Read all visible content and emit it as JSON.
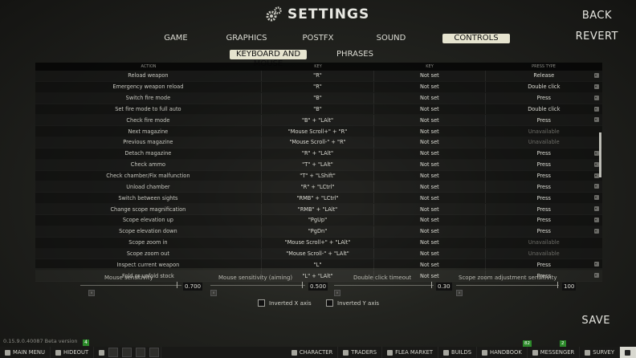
{
  "header": {
    "title": "SETTINGS"
  },
  "side": {
    "back": "BACK",
    "revert": "REVERT",
    "save": "SAVE"
  },
  "tabs": [
    {
      "label": "GAME"
    },
    {
      "label": "GRAPHICS"
    },
    {
      "label": "POSTFX"
    },
    {
      "label": "SOUND"
    },
    {
      "label": "CONTROLS"
    }
  ],
  "subtabs": [
    {
      "label": "KEYBOARD AND MOUSE"
    },
    {
      "label": "PHRASES"
    }
  ],
  "table": {
    "headers": [
      "ACTION",
      "KEY",
      "KEY",
      "PRESS TYPE"
    ],
    "rows": [
      {
        "action": "Reload weapon",
        "key": "\"R\"",
        "key2": "Not set",
        "press": "Release"
      },
      {
        "action": "Emergency weapon reload",
        "key": "\"R\"",
        "key2": "Not set",
        "press": "Double click"
      },
      {
        "action": "Switch fire mode",
        "key": "\"B\"",
        "key2": "Not set",
        "press": "Press"
      },
      {
        "action": "Set fire mode to full auto",
        "key": "\"B\"",
        "key2": "Not set",
        "press": "Double click"
      },
      {
        "action": "Check fire mode",
        "key": "\"B\" + \"LAlt\"",
        "key2": "Not set",
        "press": "Press"
      },
      {
        "action": "Next magazine",
        "key": "\"Mouse Scroll+\" + \"R\"",
        "key2": "Not set",
        "press": "Unavailable"
      },
      {
        "action": "Previous magazine",
        "key": "\"Mouse Scroll-\" + \"R\"",
        "key2": "Not set",
        "press": "Unavailable"
      },
      {
        "action": "Detach magazine",
        "key": "\"R\" + \"LAlt\"",
        "key2": "Not set",
        "press": "Press"
      },
      {
        "action": "Check ammo",
        "key": "\"T\" + \"LAlt\"",
        "key2": "Not set",
        "press": "Press"
      },
      {
        "action": "Check chamber/Fix malfunction",
        "key": "\"T\" + \"LShift\"",
        "key2": "Not set",
        "press": "Press"
      },
      {
        "action": "Unload chamber",
        "key": "\"R\" + \"LCtrl\"",
        "key2": "Not set",
        "press": "Press"
      },
      {
        "action": "Switch between sights",
        "key": "\"RMB\" + \"LCtrl\"",
        "key2": "Not set",
        "press": "Press"
      },
      {
        "action": "Change scope magnification",
        "key": "\"RMB\" + \"LAlt\"",
        "key2": "Not set",
        "press": "Press"
      },
      {
        "action": "Scope elevation up",
        "key": "\"PgUp\"",
        "key2": "Not set",
        "press": "Press"
      },
      {
        "action": "Scope elevation down",
        "key": "\"PgDn\"",
        "key2": "Not set",
        "press": "Press"
      },
      {
        "action": "Scope zoom in",
        "key": "\"Mouse Scroll+\" + \"LAlt\"",
        "key2": "Not set",
        "press": "Unavailable"
      },
      {
        "action": "Scope zoom out",
        "key": "\"Mouse Scroll-\" + \"LAlt\"",
        "key2": "Not set",
        "press": "Unavailable"
      },
      {
        "action": "Inspect current weapon",
        "key": "\"L\"",
        "key2": "Not set",
        "press": "Press"
      },
      {
        "action": "Fold or unfold stock",
        "key": "\"L\" + \"LAlt\"",
        "key2": "Not set",
        "press": "Press"
      }
    ]
  },
  "sliders": [
    {
      "label": "Mouse sensitivity",
      "value": "0.700"
    },
    {
      "label": "Mouse sensitivity (aiming)",
      "value": "0.500"
    },
    {
      "label": "Double click timeout",
      "value": "0.30"
    },
    {
      "label": "Scope zoom adjustment sensitivity",
      "value": "100"
    }
  ],
  "checks": {
    "invert_x": "Inverted X axis",
    "invert_y": "Inverted Y axis"
  },
  "footer": {
    "version": "0.15.9.0.40087 Beta version",
    "version_badge": "4",
    "badge_82": "82",
    "badge_2": "2"
  },
  "taskbar": {
    "main_menu": "MAIN MENU",
    "hideout": "HIDEOUT",
    "character": "CHARACTER",
    "traders": "TRADERS",
    "flea": "FLEA MARKET",
    "builds": "BUILDS",
    "handbook": "HANDBOOK",
    "messenger": "MESSENGER",
    "survey": "SURVEY"
  },
  "colors": {
    "accent_tab": "#e6e4cf",
    "badge_green": "#2c8a2a"
  },
  "icons": [
    "gears-icon",
    "exit-icon",
    "hideout-icon",
    "character-icon",
    "traders-icon",
    "flea-icon",
    "builds-icon",
    "handbook-icon",
    "messenger-icon",
    "survey-icon",
    "settings-icon"
  ]
}
